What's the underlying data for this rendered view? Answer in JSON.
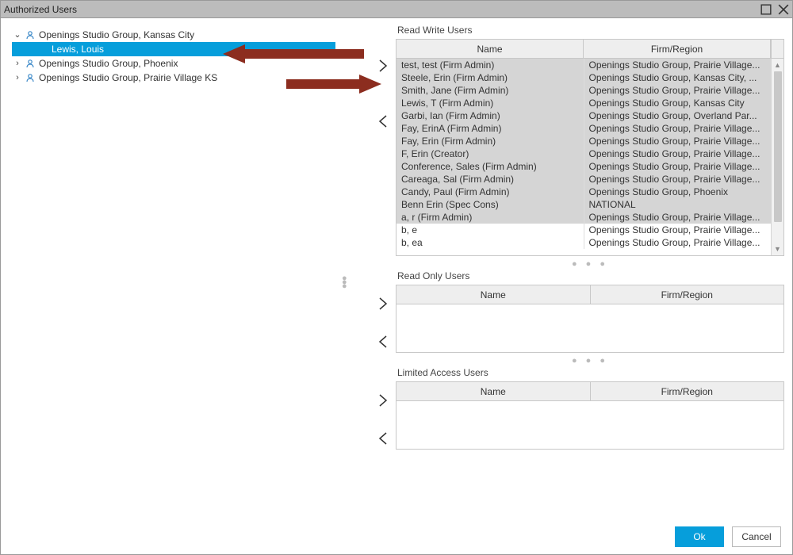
{
  "window": {
    "title": "Authorized Users"
  },
  "columns": {
    "name": "Name",
    "firm": "Firm/Region"
  },
  "tree": [
    {
      "expanded": true,
      "label": "Openings Studio Group, Kansas City",
      "children": [
        {
          "label": "Lewis, Louis",
          "selected": true
        }
      ]
    },
    {
      "expanded": false,
      "label": "Openings Studio Group, Phoenix",
      "children": []
    },
    {
      "expanded": false,
      "label": "Openings Studio Group, Prairie Village KS",
      "children": []
    }
  ],
  "sections": {
    "readWrite": {
      "title": "Read Write Users",
      "rows": [
        {
          "name": "test, test (Firm Admin)",
          "firm": "Openings Studio Group, Prairie Village...",
          "sel": true
        },
        {
          "name": "Steele, Erin (Firm Admin)",
          "firm": "Openings Studio Group, Kansas City, ...",
          "sel": true
        },
        {
          "name": "Smith, Jane (Firm Admin)",
          "firm": "Openings Studio Group, Prairie Village...",
          "sel": true
        },
        {
          "name": "Lewis, T (Firm Admin)",
          "firm": "Openings Studio Group, Kansas City",
          "sel": true
        },
        {
          "name": "Garbi, Ian (Firm Admin)",
          "firm": "Openings Studio Group, Overland Par...",
          "sel": true
        },
        {
          "name": "Fay, ErinA (Firm Admin)",
          "firm": "Openings Studio Group, Prairie Village...",
          "sel": true
        },
        {
          "name": "Fay, Erin (Firm Admin)",
          "firm": "Openings Studio Group, Prairie Village...",
          "sel": true
        },
        {
          "name": "F, Erin (Creator)",
          "firm": "Openings Studio Group, Prairie Village...",
          "sel": true
        },
        {
          "name": "Conference, Sales (Firm Admin)",
          "firm": "Openings Studio Group, Prairie Village...",
          "sel": true
        },
        {
          "name": "Careaga, Sal (Firm Admin)",
          "firm": "Openings Studio Group, Prairie Village...",
          "sel": true
        },
        {
          "name": "Candy, Paul (Firm Admin)",
          "firm": "Openings Studio Group, Phoenix",
          "sel": true
        },
        {
          "name": "Benn Erin (Spec Cons)",
          "firm": "NATIONAL",
          "sel": true
        },
        {
          "name": "a, r (Firm Admin)",
          "firm": "Openings Studio Group, Prairie Village...",
          "sel": true
        },
        {
          "name": "b, e",
          "firm": "Openings Studio Group, Prairie Village...",
          "sel": false
        },
        {
          "name": "b, ea",
          "firm": "Openings Studio Group, Prairie Village...",
          "sel": false
        }
      ]
    },
    "readOnly": {
      "title": "Read Only Users",
      "rows": []
    },
    "limited": {
      "title": "Limited Access Users",
      "rows": []
    }
  },
  "buttons": {
    "ok": "Ok",
    "cancel": "Cancel"
  }
}
